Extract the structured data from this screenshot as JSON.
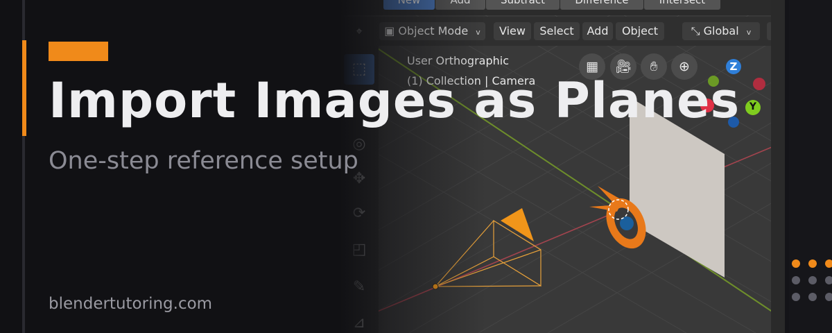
{
  "viewport": {
    "boolean_tools": {
      "new": "New",
      "add": "Add",
      "subtract": "Subtract",
      "difference": "Difference",
      "intersect": "Intersect"
    },
    "header": {
      "mode": "Object Mode",
      "view": "View",
      "select": "Select",
      "add": "Add",
      "object": "Object",
      "orientation": "Global"
    },
    "overlay_text": {
      "view_name": "User Orthographic",
      "collection": "(1) Collection | Camera"
    },
    "gizmo": {
      "z": "Z",
      "y": "Y"
    },
    "nav_icons": [
      "grid-icon",
      "camera-icon",
      "hand-icon",
      "zoom-icon"
    ],
    "tools": [
      "select-box-icon",
      "cursor-icon",
      "move-icon",
      "rotate-icon",
      "scale-icon",
      "annotate-icon",
      "measure-icon"
    ]
  },
  "branding": {
    "title": "Import Images as Planes",
    "subtitle": "One-step reference setup",
    "website": "blendertutoring.com"
  },
  "colors": {
    "accent": "#f08a1a",
    "background": "#111114",
    "title": "#eeeef0",
    "subtitle": "#8b8b94",
    "viewport_bg": "#393939",
    "selection_blue": "#4772b3"
  }
}
